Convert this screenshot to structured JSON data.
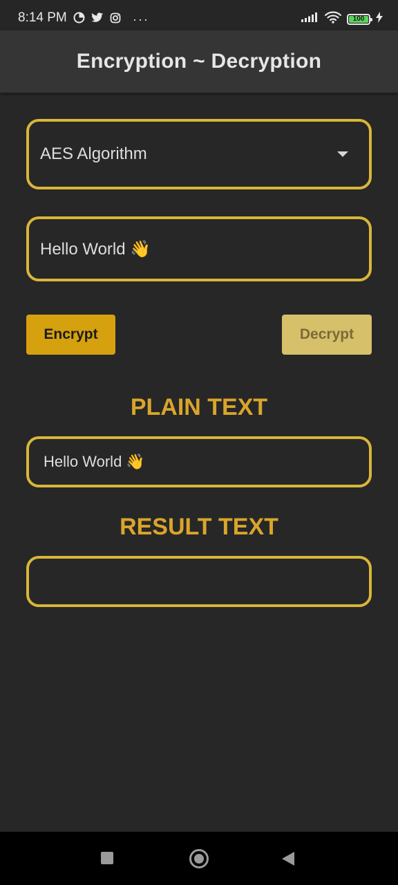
{
  "status_bar": {
    "time": "8:14 PM",
    "left_icons": [
      "data-saver-icon",
      "twitter-icon",
      "instagram-icon"
    ],
    "more": "···",
    "battery_level": "100",
    "right_icons": [
      "signal-icon",
      "wifi-icon",
      "battery-icon",
      "charging-icon"
    ]
  },
  "app_bar": {
    "title": "Encryption ~ Decryption"
  },
  "form": {
    "algorithm_selected": "AES Algorithm",
    "input_value": "Hello World 👋"
  },
  "buttons": {
    "encrypt_label": "Encrypt",
    "decrypt_label": "Decrypt"
  },
  "plain_section": {
    "heading": "PLAIN TEXT",
    "value": "Hello World 👋"
  },
  "result_section": {
    "heading": "RESULT TEXT",
    "value": ""
  },
  "nav_bar": {
    "icons": [
      "recents-icon",
      "home-icon",
      "back-icon"
    ]
  },
  "colors": {
    "background": "#272727",
    "app_bar": "#353535",
    "accent": "#d8b638",
    "heading": "#d9a52b",
    "encrypt_button": "#d6a10e",
    "decrypt_button": "#d7c06a"
  }
}
